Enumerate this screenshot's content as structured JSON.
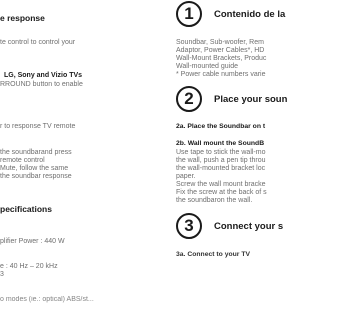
{
  "left": {
    "heading_remote": "e response",
    "remote_lines": [
      "te control to control your"
    ],
    "tv_bold": "LG, Sony and Vizio TVs",
    "tv_line": "RROUND button to enable",
    "response_line": "r to response TV remote",
    "instruction_lines": [
      "the soundbarand press",
      "remote control",
      "Mute, follow the same",
      "the soundbar response"
    ],
    "heading_specs": "pecifications",
    "spec_power": "plifier Power : 440 W",
    "spec_freq": "e : 40 Hz – 20 kHz",
    "spec_num": "3",
    "spec_cut": "o modes (ie.: optical) ABS/st..."
  },
  "right": {
    "step1": {
      "number": "1",
      "title": "Contenido de la",
      "lines": [
        "Soundbar, Sub-woofer, Rem",
        "Adaptor, Power Cables*, HD",
        "Wall-Mount Brackets, Produc",
        "Wall-mounted guide",
        "* Power cable numbers varie"
      ]
    },
    "step2": {
      "number": "2",
      "title": "Place your soun",
      "sub_a": "2a. Place the Soundbar on t",
      "sub_b": "2b. Wall mount the SoundB",
      "lines": [
        "Use tape to stick the wall-mo",
        "the wall, push a pen tip throu",
        "the wall-mounted bracket loc",
        "paper.",
        "Screw the wall mount bracke",
        "Fix the screw at the back of s",
        "the soundbaron the wall."
      ]
    },
    "step3": {
      "number": "3",
      "title": "Connect your s",
      "sub_a": "3a. Connect to your TV"
    }
  }
}
